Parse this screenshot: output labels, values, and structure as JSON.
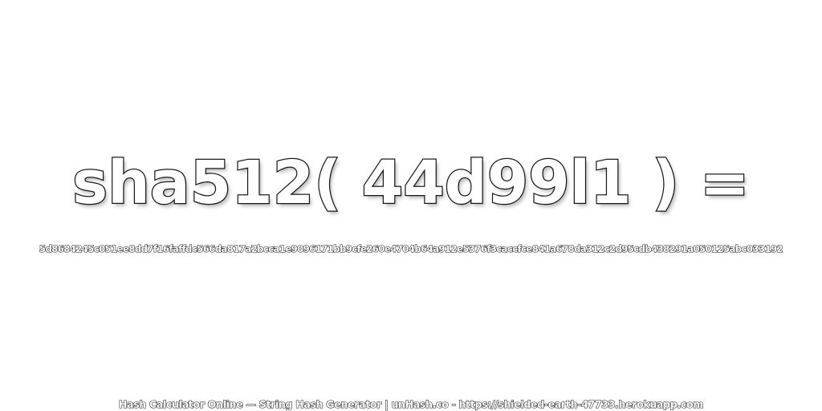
{
  "headline": "sha512( 44d99l1 ) =",
  "hash_value": "5d8684245c051ee8dd7f16faffdc566da817a2bcca1e9096171bb9cfe260e4704b64a912e5376f3caccfce841a678da312c2d95cdb438291a050125abc033192",
  "footer": "Hash Calculator Online — String Hash Generator | unHash.co - https://shielded-earth-47733.herokuapp.com",
  "colors": {
    "background": "#ffffff",
    "text_fill": "#ffffff",
    "text_outline": "#1a1a1a"
  }
}
